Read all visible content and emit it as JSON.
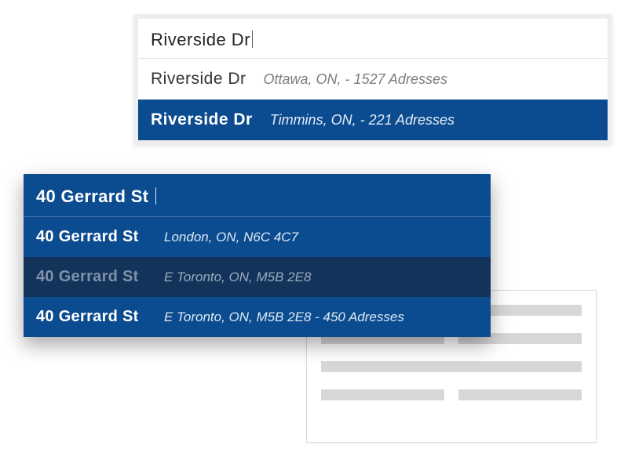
{
  "back_panel": {
    "rows": 4
  },
  "top_panel": {
    "input_value": "Riverside Dr",
    "options": [
      {
        "primary": "Riverside Dr",
        "secondary": "Ottawa, ON, - 1527 Adresses",
        "selected": false
      },
      {
        "primary": "Riverside Dr",
        "secondary": "Timmins, ON, - 221 Adresses",
        "selected": true
      }
    ]
  },
  "front_panel": {
    "input_value": "40 Gerrard St",
    "options": [
      {
        "primary": "40 Gerrard St",
        "secondary": "London, ON, N6C 4C7",
        "state": "normal"
      },
      {
        "primary": "40 Gerrard St",
        "secondary": "E Toronto, ON, M5B 2E8",
        "state": "hover"
      },
      {
        "primary": "40 Gerrard St",
        "secondary": "E Toronto, ON, M5B 2E8 - 450 Adresses",
        "state": "normal"
      }
    ]
  }
}
